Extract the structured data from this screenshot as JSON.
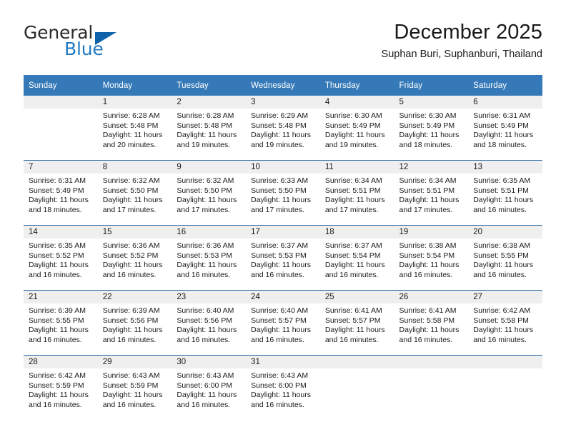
{
  "brand": {
    "name_part1": "General",
    "name_part2": "Blue",
    "flag_icon": "triangle-flag-icon",
    "accent_color": "#1f7ac4",
    "flag_color": "#1163a9"
  },
  "header": {
    "title": "December 2025",
    "subtitle": "Suphan Buri, Suphanburi, Thailand"
  },
  "calendar": {
    "header_bg": "#3579b8",
    "daynum_bg": "#efefef",
    "row_divider_color": "#2e6da4",
    "weekday_headers": [
      "Sunday",
      "Monday",
      "Tuesday",
      "Wednesday",
      "Thursday",
      "Friday",
      "Saturday"
    ],
    "weeks": [
      [
        {
          "day": "",
          "lines": []
        },
        {
          "day": "1",
          "lines": [
            "Sunrise: 6:28 AM",
            "Sunset: 5:48 PM",
            "Daylight: 11 hours",
            "and 20 minutes."
          ]
        },
        {
          "day": "2",
          "lines": [
            "Sunrise: 6:28 AM",
            "Sunset: 5:48 PM",
            "Daylight: 11 hours",
            "and 19 minutes."
          ]
        },
        {
          "day": "3",
          "lines": [
            "Sunrise: 6:29 AM",
            "Sunset: 5:48 PM",
            "Daylight: 11 hours",
            "and 19 minutes."
          ]
        },
        {
          "day": "4",
          "lines": [
            "Sunrise: 6:30 AM",
            "Sunset: 5:49 PM",
            "Daylight: 11 hours",
            "and 19 minutes."
          ]
        },
        {
          "day": "5",
          "lines": [
            "Sunrise: 6:30 AM",
            "Sunset: 5:49 PM",
            "Daylight: 11 hours",
            "and 18 minutes."
          ]
        },
        {
          "day": "6",
          "lines": [
            "Sunrise: 6:31 AM",
            "Sunset: 5:49 PM",
            "Daylight: 11 hours",
            "and 18 minutes."
          ]
        }
      ],
      [
        {
          "day": "7",
          "lines": [
            "Sunrise: 6:31 AM",
            "Sunset: 5:49 PM",
            "Daylight: 11 hours",
            "and 18 minutes."
          ]
        },
        {
          "day": "8",
          "lines": [
            "Sunrise: 6:32 AM",
            "Sunset: 5:50 PM",
            "Daylight: 11 hours",
            "and 17 minutes."
          ]
        },
        {
          "day": "9",
          "lines": [
            "Sunrise: 6:32 AM",
            "Sunset: 5:50 PM",
            "Daylight: 11 hours",
            "and 17 minutes."
          ]
        },
        {
          "day": "10",
          "lines": [
            "Sunrise: 6:33 AM",
            "Sunset: 5:50 PM",
            "Daylight: 11 hours",
            "and 17 minutes."
          ]
        },
        {
          "day": "11",
          "lines": [
            "Sunrise: 6:34 AM",
            "Sunset: 5:51 PM",
            "Daylight: 11 hours",
            "and 17 minutes."
          ]
        },
        {
          "day": "12",
          "lines": [
            "Sunrise: 6:34 AM",
            "Sunset: 5:51 PM",
            "Daylight: 11 hours",
            "and 17 minutes."
          ]
        },
        {
          "day": "13",
          "lines": [
            "Sunrise: 6:35 AM",
            "Sunset: 5:51 PM",
            "Daylight: 11 hours",
            "and 16 minutes."
          ]
        }
      ],
      [
        {
          "day": "14",
          "lines": [
            "Sunrise: 6:35 AM",
            "Sunset: 5:52 PM",
            "Daylight: 11 hours",
            "and 16 minutes."
          ]
        },
        {
          "day": "15",
          "lines": [
            "Sunrise: 6:36 AM",
            "Sunset: 5:52 PM",
            "Daylight: 11 hours",
            "and 16 minutes."
          ]
        },
        {
          "day": "16",
          "lines": [
            "Sunrise: 6:36 AM",
            "Sunset: 5:53 PM",
            "Daylight: 11 hours",
            "and 16 minutes."
          ]
        },
        {
          "day": "17",
          "lines": [
            "Sunrise: 6:37 AM",
            "Sunset: 5:53 PM",
            "Daylight: 11 hours",
            "and 16 minutes."
          ]
        },
        {
          "day": "18",
          "lines": [
            "Sunrise: 6:37 AM",
            "Sunset: 5:54 PM",
            "Daylight: 11 hours",
            "and 16 minutes."
          ]
        },
        {
          "day": "19",
          "lines": [
            "Sunrise: 6:38 AM",
            "Sunset: 5:54 PM",
            "Daylight: 11 hours",
            "and 16 minutes."
          ]
        },
        {
          "day": "20",
          "lines": [
            "Sunrise: 6:38 AM",
            "Sunset: 5:55 PM",
            "Daylight: 11 hours",
            "and 16 minutes."
          ]
        }
      ],
      [
        {
          "day": "21",
          "lines": [
            "Sunrise: 6:39 AM",
            "Sunset: 5:55 PM",
            "Daylight: 11 hours",
            "and 16 minutes."
          ]
        },
        {
          "day": "22",
          "lines": [
            "Sunrise: 6:39 AM",
            "Sunset: 5:56 PM",
            "Daylight: 11 hours",
            "and 16 minutes."
          ]
        },
        {
          "day": "23",
          "lines": [
            "Sunrise: 6:40 AM",
            "Sunset: 5:56 PM",
            "Daylight: 11 hours",
            "and 16 minutes."
          ]
        },
        {
          "day": "24",
          "lines": [
            "Sunrise: 6:40 AM",
            "Sunset: 5:57 PM",
            "Daylight: 11 hours",
            "and 16 minutes."
          ]
        },
        {
          "day": "25",
          "lines": [
            "Sunrise: 6:41 AM",
            "Sunset: 5:57 PM",
            "Daylight: 11 hours",
            "and 16 minutes."
          ]
        },
        {
          "day": "26",
          "lines": [
            "Sunrise: 6:41 AM",
            "Sunset: 5:58 PM",
            "Daylight: 11 hours",
            "and 16 minutes."
          ]
        },
        {
          "day": "27",
          "lines": [
            "Sunrise: 6:42 AM",
            "Sunset: 5:58 PM",
            "Daylight: 11 hours",
            "and 16 minutes."
          ]
        }
      ],
      [
        {
          "day": "28",
          "lines": [
            "Sunrise: 6:42 AM",
            "Sunset: 5:59 PM",
            "Daylight: 11 hours",
            "and 16 minutes."
          ]
        },
        {
          "day": "29",
          "lines": [
            "Sunrise: 6:43 AM",
            "Sunset: 5:59 PM",
            "Daylight: 11 hours",
            "and 16 minutes."
          ]
        },
        {
          "day": "30",
          "lines": [
            "Sunrise: 6:43 AM",
            "Sunset: 6:00 PM",
            "Daylight: 11 hours",
            "and 16 minutes."
          ]
        },
        {
          "day": "31",
          "lines": [
            "Sunrise: 6:43 AM",
            "Sunset: 6:00 PM",
            "Daylight: 11 hours",
            "and 16 minutes."
          ]
        },
        {
          "day": "",
          "lines": []
        },
        {
          "day": "",
          "lines": []
        },
        {
          "day": "",
          "lines": []
        }
      ]
    ]
  }
}
